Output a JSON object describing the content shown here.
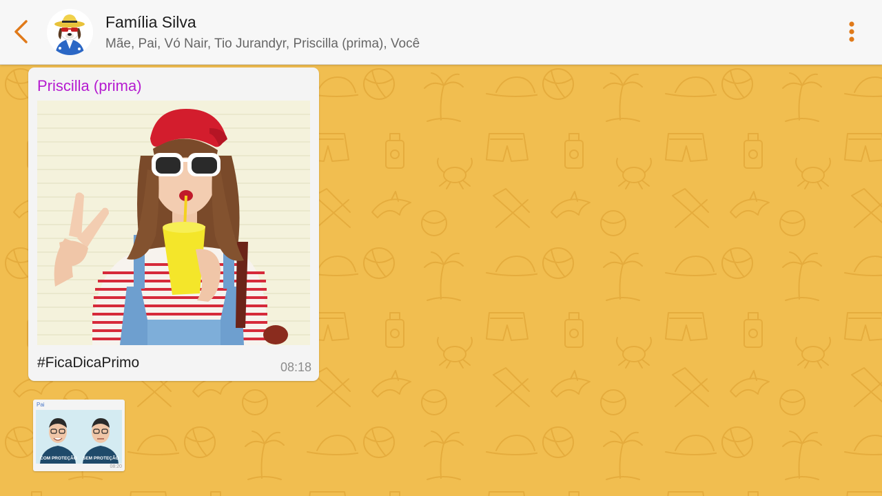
{
  "header": {
    "title": "Família Silva",
    "subtitle": "Mãe, Pai, Vó Nair, Tio Jurandyr, Priscilla (prima), Você",
    "icons": {
      "back": "chevron-left-icon",
      "menu": "more-vert-icon"
    },
    "accent_color": "#e07a1a"
  },
  "messages": [
    {
      "sender": "Priscilla (prima)",
      "caption": "#FicaDicaPrimo",
      "time": "08:18",
      "sender_color": "#b51bd0"
    },
    {
      "sender": "Pai",
      "time": "08:20",
      "labels": [
        "COM PROTEÇÃO",
        "SEM PROTEÇÃO"
      ]
    }
  ],
  "colors": {
    "wallpaper": "#f1be50",
    "pattern": "#e3a93a",
    "bubble": "#f4f4f4"
  }
}
